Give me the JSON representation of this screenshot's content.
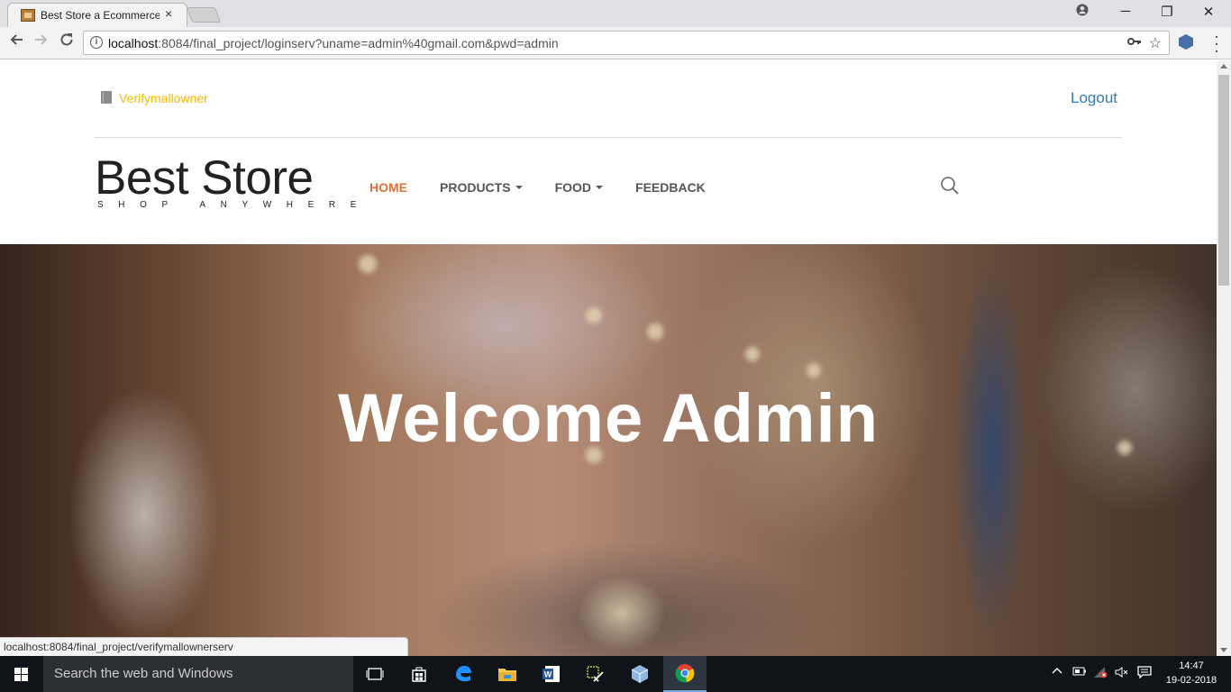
{
  "browser": {
    "tab_title": "Best Store a Ecommerce",
    "tab_close": "×",
    "url_host": "localhost",
    "url_rest": ":8084/final_project/loginserv?uname=admin%40gmail.com&pwd=admin",
    "status_text": "localhost:8084/final_project/verifymallownerserv",
    "window_controls": {
      "minimize": "─",
      "restore": "❐",
      "close": "✕"
    }
  },
  "topbar": {
    "owner_link": "Verifymallowner",
    "logout": "Logout"
  },
  "brand": {
    "name": "Best Store",
    "tagline": "SHOP ANYWHERE"
  },
  "nav": [
    {
      "label": "HOME",
      "active": true,
      "dropdown": false
    },
    {
      "label": "PRODUCTS",
      "active": false,
      "dropdown": true
    },
    {
      "label": "FOOD",
      "active": false,
      "dropdown": true
    },
    {
      "label": "FEEDBACK",
      "active": false,
      "dropdown": false
    }
  ],
  "hero": {
    "heading": "Welcome Admin"
  },
  "taskbar": {
    "search_placeholder": "Search the web and Windows",
    "time": "14:47",
    "date": "19-02-2018"
  },
  "colors": {
    "accent_active": "#e0703a",
    "owner_link": "#f5b800",
    "logout_link": "#337ab7"
  }
}
